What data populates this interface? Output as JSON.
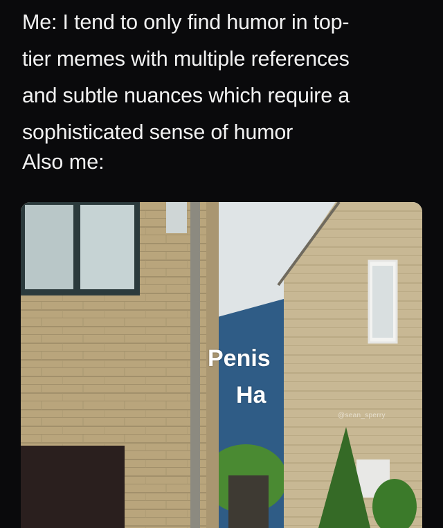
{
  "caption": {
    "lines": [
      "Me: I tend to only find humor in top-",
      "tier memes with multiple references",
      "and subtle nuances which require a",
      "sophisticated sense of humor"
    ],
    "also_me": "Also me:"
  },
  "photo": {
    "sign_line1": "Penis",
    "sign_line2": "Ha",
    "watermark": "@sean_sperry",
    "colors": {
      "sky": "#dfe4e6",
      "blue_building": "#2f5c86",
      "brick": "#b7a37b",
      "house_wall": "#c7b68f",
      "trees": "#3f7a2e"
    }
  }
}
